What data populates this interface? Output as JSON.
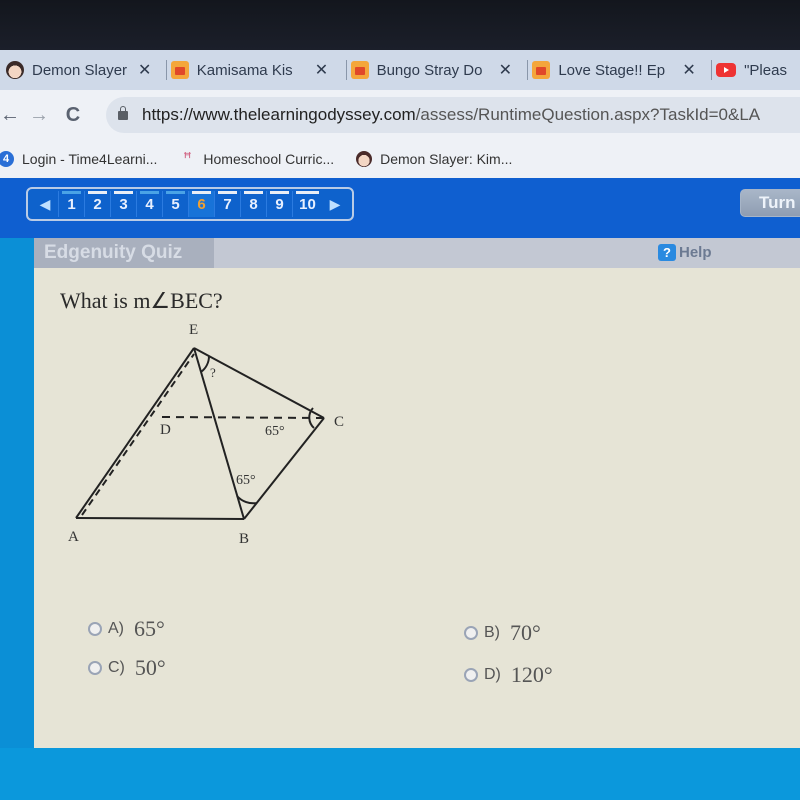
{
  "browser": {
    "tabs": [
      {
        "title": "Demon Slayer:",
        "icon": "anime-face-icon",
        "close": "✕"
      },
      {
        "title": "Kamisama Kis",
        "icon": "crunchyroll-icon",
        "close": "✕"
      },
      {
        "title": "Bungo Stray Do",
        "icon": "crunchyroll-icon",
        "close": "✕"
      },
      {
        "title": "Love Stage!! Ep",
        "icon": "crunchyroll-icon",
        "close": "✕"
      },
      {
        "title": "\"Pleas",
        "icon": "youtube-icon"
      }
    ],
    "nav": {
      "back": "←",
      "forward": "→",
      "reload": "C"
    },
    "url": {
      "host": "https://www.thelearningodyssey.com",
      "path": "/assess/RuntimeQuestion.aspx?TaskId=0&LA"
    },
    "bookmarks": [
      {
        "label": "Login - Time4Learni...",
        "icon": "time4learning-icon"
      },
      {
        "label": "Homeschool Curric...",
        "icon": "flamingo-icon"
      },
      {
        "label": "Demon Slayer: Kim...",
        "icon": "anime-face-icon"
      }
    ]
  },
  "quiz_nav": {
    "prev": "◀",
    "next": "▶",
    "questions": [
      {
        "label": "1",
        "answered": false
      },
      {
        "label": "2",
        "answered": true
      },
      {
        "label": "3",
        "answered": true
      },
      {
        "label": "4",
        "answered": false
      },
      {
        "label": "5",
        "answered": false
      },
      {
        "label": "6",
        "answered": true,
        "current": true
      },
      {
        "label": "7",
        "answered": true
      },
      {
        "label": "8",
        "answered": true
      },
      {
        "label": "9",
        "answered": true
      },
      {
        "label": "10",
        "answered": true
      }
    ],
    "turn_in": "Turn In"
  },
  "quiz": {
    "title": "Edgenuity Quiz",
    "help": "Help",
    "help_icon": "?",
    "question": "What is m∠BEC?",
    "diagram": {
      "vertices": {
        "E": "E",
        "D": "D",
        "C": "C",
        "A": "A",
        "B": "B"
      },
      "angle_labels": {
        "BEC": "?",
        "DCB": "65°",
        "EBC": "65°"
      }
    },
    "answers": [
      {
        "letter": "A)",
        "value": "65°",
        "selected": false
      },
      {
        "letter": "B)",
        "value": "70°",
        "selected": false
      },
      {
        "letter": "C)",
        "value": "50°",
        "selected": false
      },
      {
        "letter": "D)",
        "value": "120°",
        "selected": false
      }
    ]
  },
  "colors": {
    "app_blue": "#0f5fd0",
    "current_question": "#f0a030",
    "page_bg": "#e6e4d6"
  }
}
